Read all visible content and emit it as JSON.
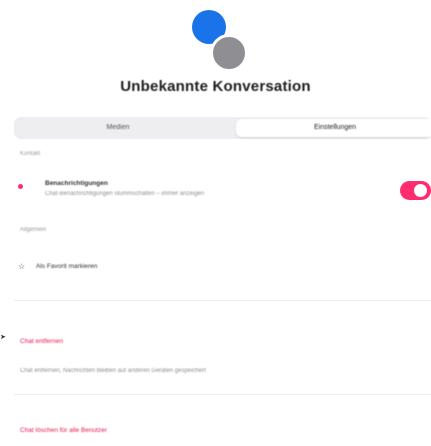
{
  "header": {
    "title": "Unbekannte Konversation"
  },
  "tabs": {
    "left_label": "Medien",
    "right_label": "Einstellungen"
  },
  "sections": {
    "section1_label": "Kontakt",
    "row1_title": "Benachrichtigungen",
    "row1_subtitle": "Chat-Benachrichtigungen stummschalten – immer anzeigen",
    "section2_label": "Allgemein",
    "row2_label": "Als Favorit markieren",
    "delete_chat_label": "Chat entfernen",
    "delete_chat_hint": "Chat entfernen, Nachrichten bleiben auf anderen Geräten gespeichert",
    "leave_label": "Chat löschen für alle Benutzer"
  },
  "colors": {
    "accent": "#ff2d6f",
    "avatar_primary": "#1a73e8",
    "avatar_secondary": "#8e8e93"
  },
  "toggle": {
    "state": "on"
  }
}
